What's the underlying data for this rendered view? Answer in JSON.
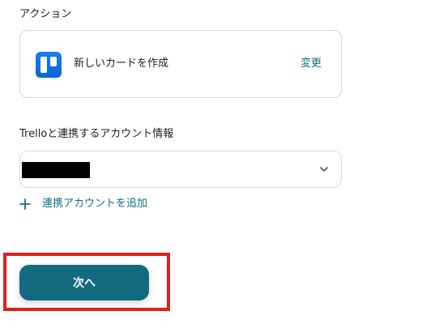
{
  "action_section": {
    "label": "アクション",
    "action_name": "新しいカードを作成",
    "change_label": "変更",
    "app_icon": "trello-icon"
  },
  "account_section": {
    "label": "Trelloと連携するアカウント情報",
    "selected_value": "",
    "value_redacted": true,
    "chevron_icon": "chevron-down-icon",
    "add_account_label": "連携アカウントを追加",
    "add_icon": "plus-icon"
  },
  "footer": {
    "next_label": "次へ"
  },
  "colors": {
    "accent": "#136e86",
    "button": "#136a80",
    "highlight": "#e11f1f",
    "trello_blue": "#0c66d1",
    "border": "#d6d9de"
  }
}
